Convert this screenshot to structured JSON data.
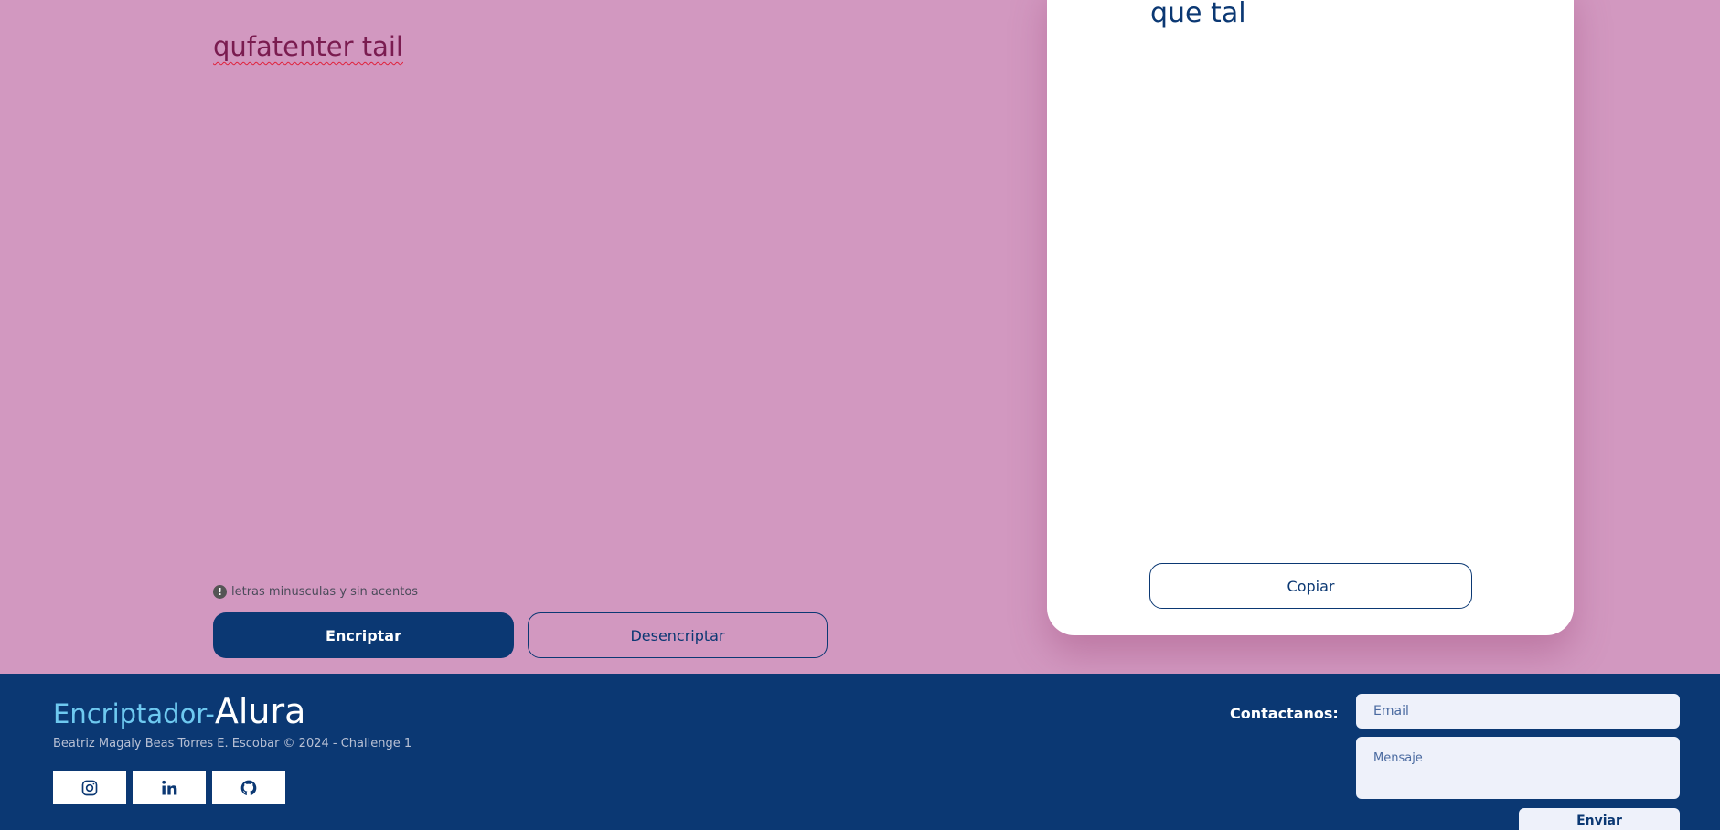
{
  "colors": {
    "background": "#d298c0",
    "primary": "#0b3873",
    "input_text": "#7a1c50",
    "brand_accent": "#6ec9f0",
    "field_bg": "#eef1fa"
  },
  "encryptor": {
    "input_text": "qufatenter tail",
    "hint_icon": "exclamation-icon",
    "hint_text": "letras minusculas y sin acentos",
    "encrypt_label": "Encriptar",
    "decrypt_label": "Desencriptar"
  },
  "output": {
    "text": "que tal",
    "copy_label": "Copiar"
  },
  "footer": {
    "brand_prefix": "Encriptador-",
    "brand_name": "Alura",
    "credits": "Beatriz Magaly Beas Torres E. Escobar © 2024 - Challenge 1",
    "socials": [
      {
        "icon": "instagram-icon"
      },
      {
        "icon": "linkedin-icon"
      },
      {
        "icon": "github-icon"
      }
    ],
    "contact_label": "Contactanos:",
    "email_placeholder": "Email",
    "message_placeholder": "Mensaje",
    "send_label": "Enviar"
  }
}
